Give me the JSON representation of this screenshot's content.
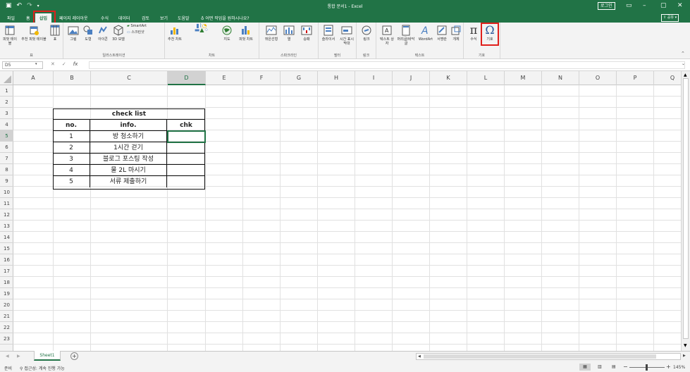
{
  "title": "통합 문서1 - Excel",
  "title_bar": {
    "login": "로그인",
    "share": "공유"
  },
  "tabs": [
    "파일",
    "홈",
    "삽입",
    "페이지 레이아웃",
    "수식",
    "데이터",
    "검토",
    "보기",
    "도움말",
    "어떤 작업을 원하시나요?"
  ],
  "active_tab": "삽입",
  "ribbon": {
    "groups": [
      "표",
      "일러스트레이션",
      "차트",
      "투어",
      "스파크라인",
      "필터",
      "링크",
      "텍스트",
      "기호"
    ],
    "buttons": {
      "pivot": "피벗 테이블",
      "recommended_pivot": "추천 피벗 테이블",
      "table": "표",
      "picture": "그림",
      "shapes": "도형",
      "icons": "아이콘",
      "model3d": "3D 모델",
      "smartart": "SmartArt",
      "screenshot": "스크린샷",
      "recommended_charts": "추천 차트",
      "map": "지도",
      "pivot_chart": "피벗 차트",
      "line": "꺾은선형",
      "column": "열",
      "winloss": "승패",
      "slicer": "슬라이서",
      "timeline": "시간 표시 막대",
      "link": "링크",
      "textbox": "텍스트 상자",
      "header_footer": "머리글/바닥글",
      "wordart": "WordArt",
      "signature": "서명란",
      "object": "개체",
      "equation": "수식",
      "symbol": "기호"
    }
  },
  "formula_bar": {
    "name_box": "D5",
    "fx": "fx",
    "value": ""
  },
  "columns": [
    "A",
    "B",
    "C",
    "D",
    "E",
    "F",
    "G",
    "H",
    "I",
    "J",
    "K",
    "L",
    "M",
    "N",
    "O",
    "P",
    "Q"
  ],
  "rows": [
    "1",
    "2",
    "3",
    "4",
    "5",
    "6",
    "7",
    "8",
    "9",
    "10",
    "11",
    "12",
    "13",
    "14",
    "15",
    "16",
    "17",
    "18",
    "19",
    "20",
    "21",
    "22",
    "23"
  ],
  "table": {
    "title": "check list",
    "headers": [
      "no.",
      "info.",
      "chk"
    ],
    "rows": [
      [
        "1",
        "방 청소하기",
        ""
      ],
      [
        "2",
        "1시간 걷기",
        ""
      ],
      [
        "3",
        "블로그 포스팅 작성",
        ""
      ],
      [
        "4",
        "물 2L 마시기",
        ""
      ],
      [
        "5",
        "서류 제출하기",
        ""
      ]
    ]
  },
  "sheet_tabs": [
    "Sheet1"
  ],
  "status_bar": {
    "ready": "준비",
    "accessibility": "접근성: 계속 진행 가능",
    "zoom": "145%"
  }
}
